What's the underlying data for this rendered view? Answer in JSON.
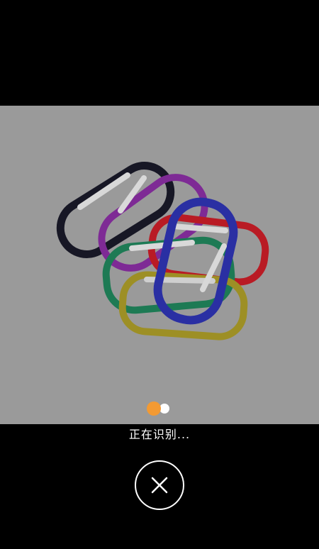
{
  "scan": {
    "status_text": "正在识别...",
    "photo_subject": "carabiners"
  },
  "controls": {
    "close_icon": "close-icon"
  },
  "colors": {
    "background": "#000000",
    "photo_overlay": "#9a9a9a",
    "loading_primary": "#f39a33",
    "loading_secondary": "#ffffff"
  }
}
